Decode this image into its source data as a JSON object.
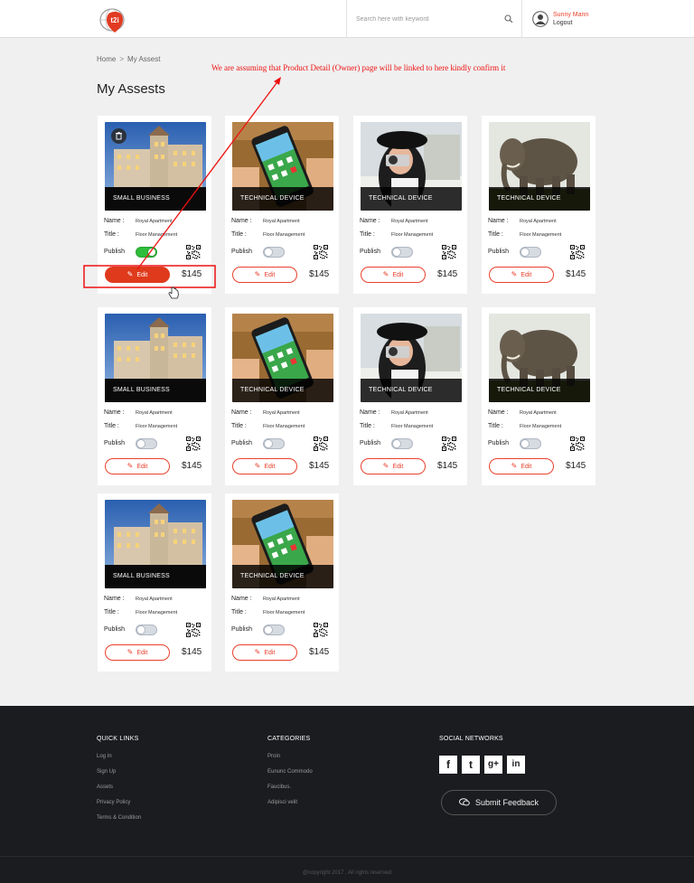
{
  "header": {
    "search_placeholder": "Search here with keyword",
    "user_name": "Sunny Mann",
    "logout_label": "Logout"
  },
  "breadcrumb": {
    "home": "Home",
    "separator": ">",
    "current": "My Assest"
  },
  "page_title": "My Assests",
  "annotation_note": "We are assuming that Product Detail (Owner) page will be linked to here kindly confirm it",
  "labels": {
    "name": "Name :",
    "title": "Title :",
    "publish": "Publish",
    "edit": "Edit"
  },
  "cards": [
    {
      "caption": "SMALL BUSINESS",
      "name": "Royal Apartment",
      "title": "Floor Management",
      "price": "$145",
      "published": true,
      "image": "building"
    },
    {
      "caption": "TECHNICAL DEVICE",
      "name": "Royal Apartment",
      "title": "Floor Management",
      "price": "$145",
      "published": false,
      "image": "phone"
    },
    {
      "caption": "TECHNICAL DEVICE",
      "name": "Royal Apartment",
      "title": "Floor Management",
      "price": "$145",
      "published": false,
      "image": "camera"
    },
    {
      "caption": "TECHNICAL DEVICE",
      "name": "Royal Apartment",
      "title": "Floor Management",
      "price": "$145",
      "published": false,
      "image": "elephant"
    },
    {
      "caption": "SMALL BUSINESS",
      "name": "Royal Apartment",
      "title": "Floor Management",
      "price": "$145",
      "published": false,
      "image": "building"
    },
    {
      "caption": "TECHNICAL DEVICE",
      "name": "Royal Apartment",
      "title": "Floor Management",
      "price": "$145",
      "published": false,
      "image": "phone"
    },
    {
      "caption": "TECHNICAL DEVICE",
      "name": "Royal Apartment",
      "title": "Floor Management",
      "price": "$145",
      "published": false,
      "image": "camera"
    },
    {
      "caption": "TECHNICAL DEVICE",
      "name": "Royal Apartment",
      "title": "Floor Management",
      "price": "$145",
      "published": false,
      "image": "elephant"
    },
    {
      "caption": "SMALL BUSINESS",
      "name": "Royal Apartment",
      "title": "Floor Management",
      "price": "$145",
      "published": false,
      "image": "building"
    },
    {
      "caption": "TECHNICAL DEVICE",
      "name": "Royal Apartment",
      "title": "Floor Management",
      "price": "$145",
      "published": false,
      "image": "phone"
    }
  ],
  "footer": {
    "quick_links_title": "QUICK LINKS",
    "quick_links": [
      "Log In",
      "Sign Up",
      "Assets",
      "Privacy Policy",
      "Terms & Condition"
    ],
    "categories_title": "CATEGORIES",
    "categories": [
      "Proin",
      "Eununc Commodo",
      "Faucibus.",
      "Adipisci velit"
    ],
    "social_title": "SOCIAL NETWORKS",
    "social": [
      {
        "icon": "facebook-icon",
        "glyph": "f"
      },
      {
        "icon": "twitter-icon",
        "glyph": "t"
      },
      {
        "icon": "google-plus-icon",
        "glyph": "g+"
      },
      {
        "icon": "linkedin-icon",
        "glyph": "in"
      }
    ],
    "feedback_label": "Submit Feedback",
    "copyright": "@copyright 2017 . All rights reserved"
  },
  "colors": {
    "accent": "#e8412c",
    "toggle_on": "#2ebd3b",
    "footer_bg": "#1b1c1f",
    "annotation": "#e11111"
  }
}
